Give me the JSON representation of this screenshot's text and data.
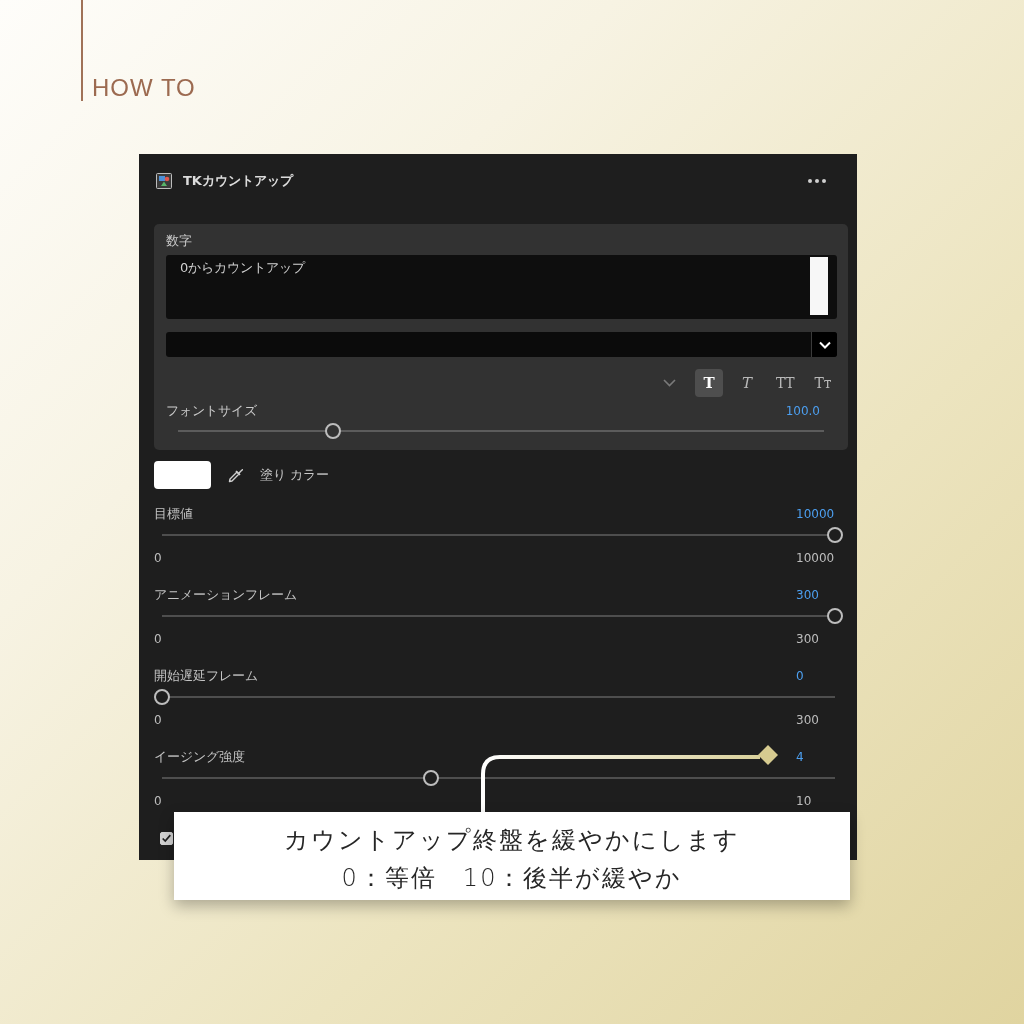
{
  "heading": "HOW TO",
  "panel": {
    "title": "TKカウントアップ",
    "text_group": {
      "label": "数字",
      "text": "0からカウントアップ",
      "style_buttons": [
        {
          "label": "T",
          "kind": "bold",
          "selected": true
        },
        {
          "label": "T",
          "kind": "italic",
          "selected": false
        },
        {
          "label": "TT",
          "kind": "caps",
          "selected": false
        },
        {
          "label": "Tᴛ",
          "kind": "small_caps",
          "selected": false
        }
      ],
      "font_size": {
        "label": "フォントサイズ",
        "value": "100.0",
        "level": 0.24
      }
    },
    "fill": {
      "label": "塗り カラー",
      "color": "#ffffff"
    },
    "sliders": [
      {
        "label": "目標値",
        "value": "10000",
        "min": "0",
        "max": "10000",
        "level": 1
      },
      {
        "label": "アニメーションフレーム",
        "value": "300",
        "min": "0",
        "max": "300",
        "level": 1
      },
      {
        "label": "開始遅延フレーム",
        "value": "0",
        "min": "0",
        "max": "300",
        "level": 0
      },
      {
        "label": "イージング強度",
        "value": "4",
        "min": "0",
        "max": "10",
        "level": 0.4
      }
    ],
    "checkbox": {
      "checked": true
    }
  },
  "callout": {
    "lines": [
      "カウントアップ終盤を緩やかにします",
      "0：等倍　10：後半が緩やか"
    ]
  }
}
